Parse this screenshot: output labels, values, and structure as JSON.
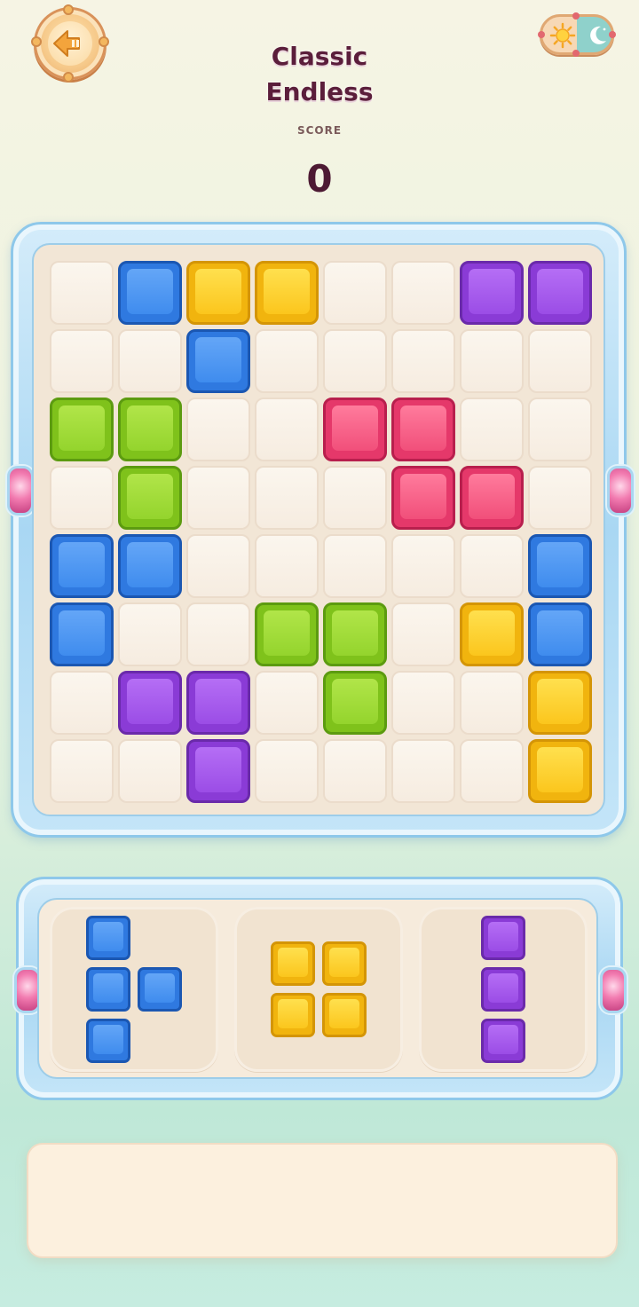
{
  "header": {
    "title_line1": "Classic",
    "title_line2": "Endless",
    "score_label": "SCORE",
    "score_value": "0",
    "pause_icon": "back-pause-icon",
    "theme_toggle_icons": [
      "sun-icon",
      "moon-icon"
    ]
  },
  "board": {
    "size": 8,
    "rows": [
      [
        "",
        "blue",
        "yellow",
        "yellow",
        "",
        "",
        "purple",
        "purple"
      ],
      [
        "",
        "",
        "blue",
        "",
        "",
        "",
        "",
        ""
      ],
      [
        "green",
        "green",
        "",
        "",
        "red",
        "red",
        "",
        ""
      ],
      [
        "",
        "green",
        "",
        "",
        "",
        "red",
        "red",
        ""
      ],
      [
        "blue",
        "blue",
        "",
        "",
        "",
        "",
        "",
        "blue"
      ],
      [
        "blue",
        "",
        "",
        "green",
        "green",
        "",
        "yellow",
        "blue"
      ],
      [
        "",
        "purple",
        "purple",
        "",
        "green",
        "",
        "",
        "yellow"
      ],
      [
        "",
        "",
        "purple",
        "",
        "",
        "",
        "",
        "yellow"
      ]
    ]
  },
  "tray": {
    "pieces": [
      {
        "color": "blue",
        "cells": [
          [
            0,
            0
          ],
          [
            1,
            0
          ],
          [
            1,
            1
          ],
          [
            2,
            0
          ]
        ]
      },
      {
        "color": "yellow",
        "cells": [
          [
            0,
            0
          ],
          [
            0,
            1
          ],
          [
            1,
            0
          ],
          [
            1,
            1
          ]
        ]
      },
      {
        "color": "purple",
        "cells": [
          [
            0,
            0
          ],
          [
            1,
            0
          ],
          [
            2,
            0
          ]
        ]
      }
    ]
  },
  "colors": {
    "blue": "#2f79e0",
    "yellow": "#f1b40e",
    "purple": "#8a3bd6",
    "green": "#7fc21b",
    "red": "#e5386a",
    "title": "#5b1e3b",
    "frame": "#a9d7f3"
  }
}
